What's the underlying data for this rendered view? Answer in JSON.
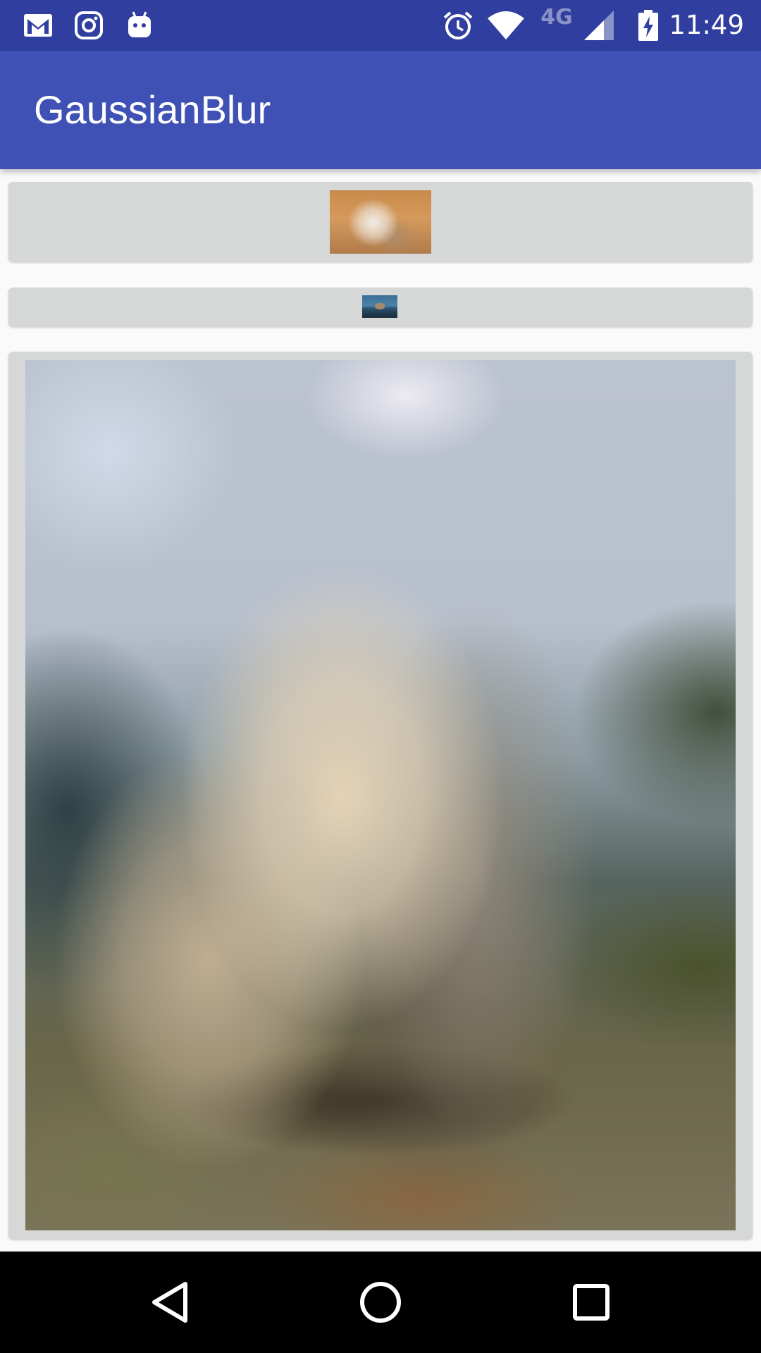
{
  "status_bar": {
    "time": "11:49",
    "network_label": "4G",
    "icons": [
      "gmail-icon",
      "instagram-icon",
      "android-icon",
      "alarm-icon",
      "wifi-icon",
      "signal-icon",
      "battery-charging-icon"
    ]
  },
  "app_bar": {
    "title": "GaussianBlur"
  },
  "colors": {
    "status_bar": "#303f9f",
    "app_bar": "#3f51b5",
    "button_bg": "#d6d7d7",
    "background": "#fafafa"
  },
  "navigation": {
    "buttons": [
      "back",
      "home",
      "recents"
    ]
  }
}
